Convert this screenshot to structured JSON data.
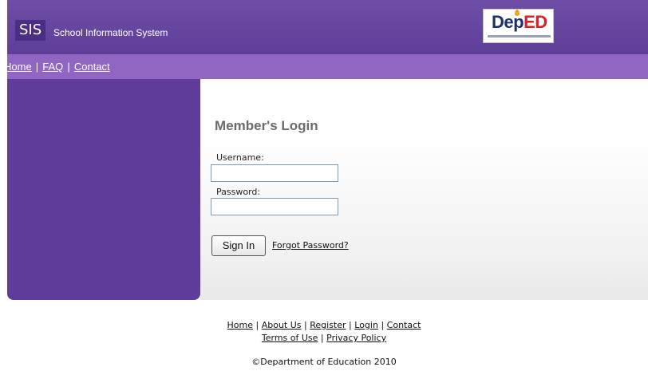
{
  "header": {
    "sis_label": "SIS",
    "app_title": "School Information System",
    "logo_dep": "Dep",
    "logo_ed": "ED"
  },
  "nav": {
    "home": "Home",
    "faq": "FAQ",
    "contact": "Contact",
    "separator": "|"
  },
  "login": {
    "title": "Member's Login",
    "username_label": "Username:",
    "password_label": "Password:",
    "username_value": "",
    "password_value": "",
    "sign_in": "Sign In",
    "forgot": "Forgot Password?"
  },
  "footer": {
    "home": "Home",
    "about": "About Us",
    "register": "Register",
    "login": "Login",
    "contact": "Contact",
    "terms": "Terms of Use",
    "privacy": "Privacy Policy",
    "separator": "|",
    "copyright": "©Department of Education 2010"
  },
  "colors": {
    "header": "#6e4ea6",
    "navbar": "#9166c3",
    "sidebar": "#5f3b9a"
  }
}
